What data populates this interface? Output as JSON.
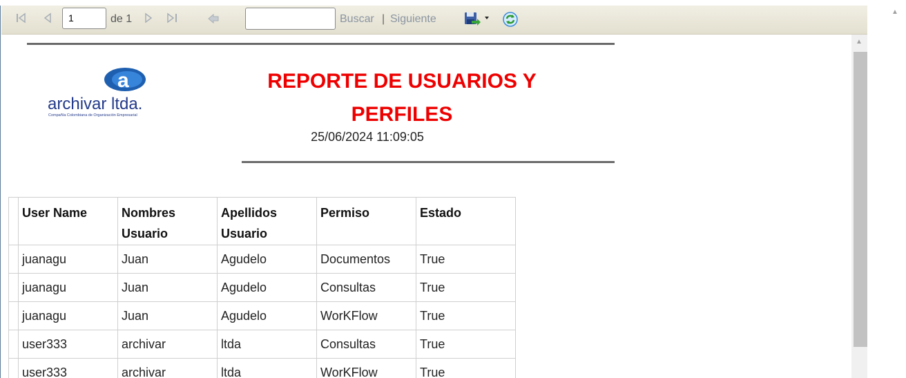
{
  "toolbar": {
    "first_icon": "first-page-icon",
    "prev_icon": "previous-page-icon",
    "page_value": "1",
    "page_of": "de 1",
    "next_icon": "next-page-icon",
    "last_icon": "last-page-icon",
    "back_icon": "back-icon",
    "search_value": "",
    "find_label": "Buscar",
    "separator": "|",
    "next_label": "Siguiente",
    "export_icon": "save-export-icon",
    "refresh_icon": "refresh-icon"
  },
  "report": {
    "logo_text": "archivar ltda.",
    "logo_subtext": "Compañía Colombiana de Organización Empresarial",
    "title": "REPORTE DE USUARIOS Y PERFILES",
    "date": "25/06/2024 11:09:05",
    "title_color": "#ee0000",
    "columns": [
      "User Name",
      "Nombres Usuario",
      "Apellidos Usuario",
      "Permiso",
      "Estado"
    ],
    "rows": [
      [
        "juanagu",
        "Juan",
        "Agudelo",
        "Documentos",
        "True"
      ],
      [
        "juanagu",
        "Juan",
        "Agudelo",
        "Consultas",
        "True"
      ],
      [
        "juanagu",
        "Juan",
        "Agudelo",
        "WorKFlow",
        "True"
      ],
      [
        "user333",
        "archivar",
        "ltda",
        "Consultas",
        "True"
      ],
      [
        "user333",
        "archivar",
        "ltda",
        "WorKFlow",
        "True"
      ]
    ]
  }
}
